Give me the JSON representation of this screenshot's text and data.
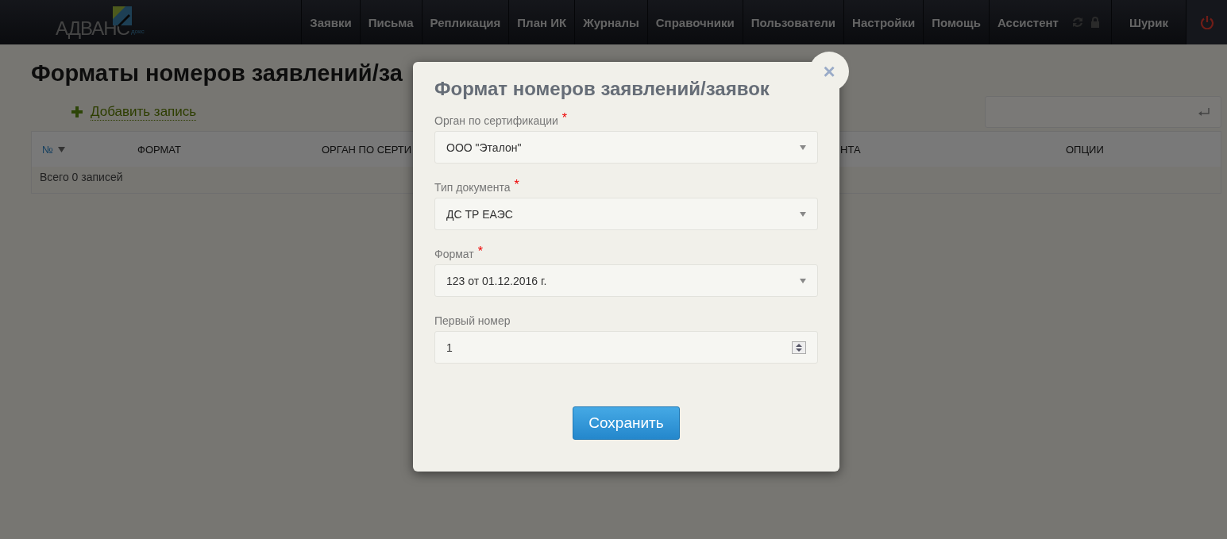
{
  "header": {
    "logo": {
      "text": "АДВАНС",
      "subtext": "докс"
    },
    "nav": [
      "Заявки",
      "Письма",
      "Репликация",
      "План ИК",
      "Журналы",
      "Справочники",
      "Пользователи",
      "Настройки",
      "Помощь",
      "Ассистент"
    ],
    "user": "Шурик"
  },
  "page": {
    "title": "Форматы номеров заявлений/за",
    "add_link": "Добавить запись",
    "table": {
      "columns": [
        {
          "label": "№",
          "sortable": true
        },
        {
          "label": "ФОРМАТ",
          "sortable": false
        },
        {
          "label": "ОРГАН ПО СЕРТИ",
          "sortable": false
        },
        {
          "label": "НТА",
          "sortable": false
        },
        {
          "label": "ОПЦИИ",
          "sortable": false
        }
      ],
      "footer": "Всего 0 записей"
    }
  },
  "dialog": {
    "title": "Формат номеров заявлений/заявок",
    "close": "×",
    "fields": [
      {
        "kind": "select",
        "label": "Орган по сертификации",
        "required_mark": "*",
        "value": "ООО \"Эталон\""
      },
      {
        "kind": "select",
        "label": "Тип документа",
        "required_mark": "*",
        "value": "ДС ТР ЕАЭС"
      },
      {
        "kind": "select",
        "label": "Формат",
        "required_mark": "*",
        "value": "123 от 01.12.2016 г."
      },
      {
        "kind": "number",
        "label": "Первый номер",
        "value": "1"
      }
    ],
    "save_button": "Сохранить"
  }
}
